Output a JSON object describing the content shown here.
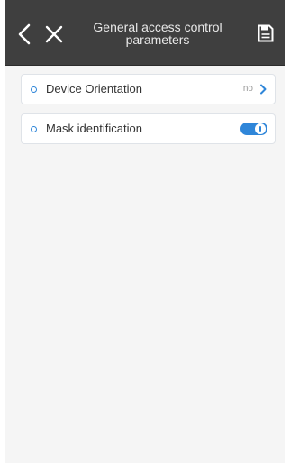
{
  "header": {
    "title_line1": "General access control",
    "title_line2": "parameters",
    "back_icon": "chevron-left-icon",
    "close_icon": "close-icon",
    "save_icon": "floppy-disk-icon",
    "background": "#3f3f3f"
  },
  "settings": [
    {
      "label": "Device Orientation",
      "value": "no",
      "control": "chevron-right"
    },
    {
      "label": "Mask identification",
      "control": "toggle",
      "enabled": true
    }
  ],
  "colors": {
    "accent": "#2f86d9"
  }
}
